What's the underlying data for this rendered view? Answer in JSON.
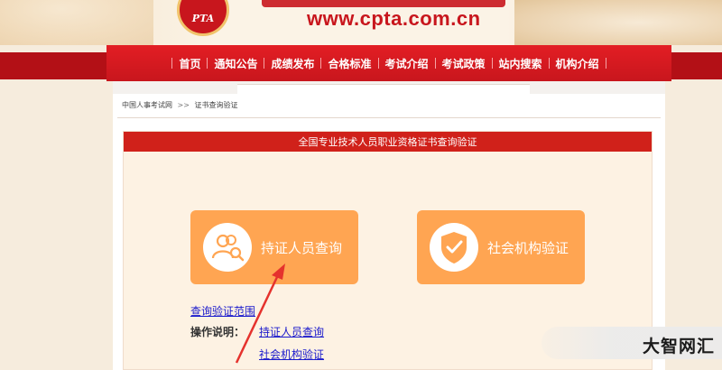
{
  "header": {
    "logo_text": "PTA",
    "url": "www.cpta.com.cn"
  },
  "nav": {
    "items": [
      "首页",
      "通知公告",
      "成绩发布",
      "合格标准",
      "考试介绍",
      "考试政策",
      "站内搜索",
      "机构介绍"
    ]
  },
  "breadcrumb": {
    "home": "中国人事考试网",
    "separator": ">>",
    "current": "证书查询验证"
  },
  "panel": {
    "title": "全国专业技术人员职业资格证书查询验证",
    "cards": {
      "person_label": "持证人员查询",
      "org_label": "社会机构验证"
    },
    "scope_link": "查询验证范围",
    "instructions_label": "操作说明：",
    "instruction_links": [
      "持证人员查询",
      "社会机构验证"
    ]
  },
  "watermark": "大智网汇",
  "colors": {
    "brand_red": "#c8161d",
    "card_orange": "#ffa552",
    "link_blue": "#1a1acc",
    "arrow_red": "#e5322d"
  }
}
